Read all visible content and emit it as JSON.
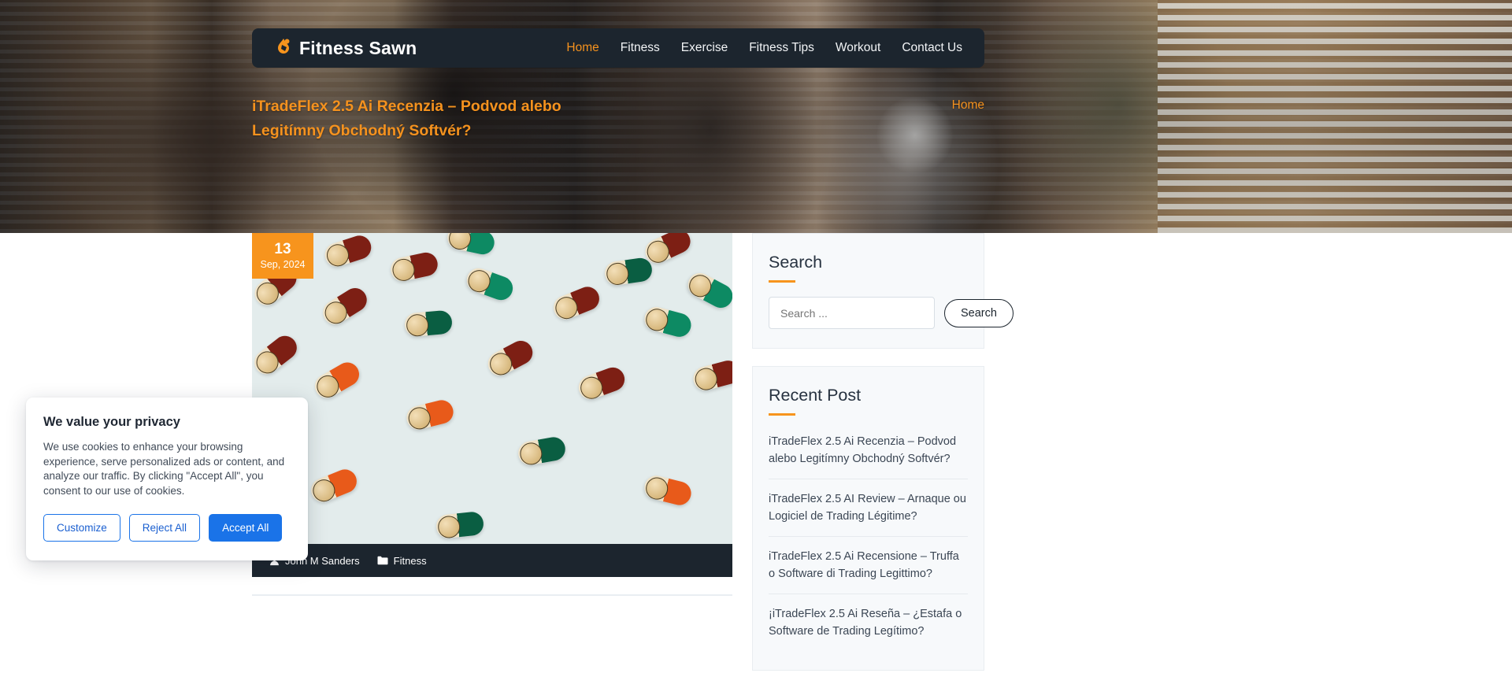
{
  "site": {
    "brand_name": "Fitness Sawn",
    "brand_icon": "flame-dumbbell-icon"
  },
  "nav": {
    "items": [
      {
        "label": "Home",
        "active": true
      },
      {
        "label": "Fitness",
        "active": false
      },
      {
        "label": "Exercise",
        "active": false
      },
      {
        "label": "Fitness Tips",
        "active": false
      },
      {
        "label": "Workout",
        "active": false
      },
      {
        "label": "Contact Us",
        "active": false
      }
    ]
  },
  "hero": {
    "title": "iTradeFlex 2.5 Ai Recenzia – Podvod alebo Legitímny Obchodný Softvér?",
    "breadcrumb": "Home"
  },
  "article": {
    "date_day": "13",
    "date_rest": "Sep, 2024",
    "author": "John M Sanders",
    "category": "Fitness",
    "author_icon": "user-icon",
    "category_icon": "folder-icon"
  },
  "sidebar": {
    "search": {
      "title": "Search",
      "placeholder": "Search ...",
      "value": "",
      "button_label": "Search"
    },
    "recent": {
      "title": "Recent Post",
      "items": [
        "iTradeFlex 2.5 Ai Recenzia – Podvod alebo Legitímny Obchodný Softvér?",
        "iTradeFlex 2.5 AI Review – Arnaque ou Logiciel de Trading Légitime?",
        "iTradeFlex 2.5 Ai Recensione – Truffa o Software di Trading Legittimo?",
        "¡iTradeFlex 2.5 Ai Reseña – ¿Estafa o Software de Trading Legítimo?"
      ]
    }
  },
  "cookie": {
    "title": "We value your privacy",
    "text": "We use cookies to enhance your browsing experience, serve personalized ads or content, and analyze our traffic. By clicking \"Accept All\", you consent to our use of cookies.",
    "customize_label": "Customize",
    "reject_label": "Reject All",
    "accept_label": "Accept All"
  },
  "colors": {
    "accent": "#f7941d",
    "dark": "#1c252e",
    "link_blue": "#1a73e8"
  }
}
